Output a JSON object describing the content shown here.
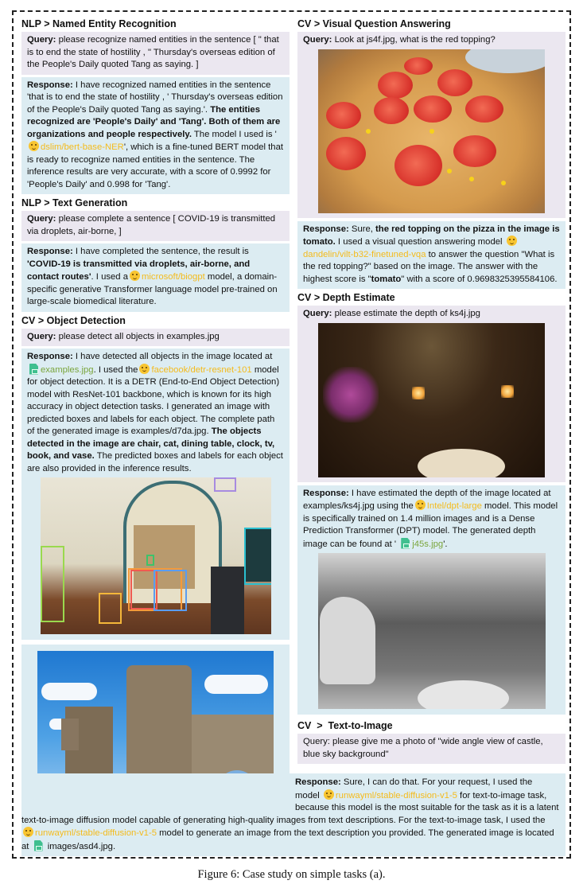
{
  "caption": "Figure 6: Case study on simple tasks (a).",
  "labels": {
    "query": "Query:",
    "response": "Response:"
  },
  "ner": {
    "heading": "NLP > Named Entity Recognition",
    "query": "please recognize named entities in the sentence [ \" that is to end the state of hostility , \" Thursday's overseas edition of the People's Daily quoted Tang as saying. ]",
    "response_1": "I have recognized named entities in the sentence 'that is to end the state of hostility , ' Thursday's overseas edition of the People's Daily quoted Tang as saying.'.",
    "response_bold": "The entities recognized are 'People's Daily' and 'Tang'. Both of them are organizations and people respectively.",
    "response_2": "The model I used is '",
    "model": "dslim/bert-base-NER",
    "response_3": "', which is a fine-tuned BERT model that is ready to recognize named entities in the sentence. The inference results are very accurate, with a score of 0.9992 for 'People's Daily' and 0.998 for 'Tang'."
  },
  "textgen": {
    "heading": "NLP > Text Generation",
    "query": "please complete a sentence [ COVID-19 is transmitted via droplets, air-borne, ]",
    "response_1": "I have completed the sentence, the result is ",
    "response_bold": "'COVID-19 is transmitted via droplets, air-borne, and contact routes'",
    "response_2": ". I used a",
    "model": "microsoft/biogpt",
    "response_3": " model,  a domain-specific generative Transformer language model pre-trained on large-scale biomedical literature."
  },
  "objdet": {
    "heading": "CV > Object Detection",
    "query": "please detect all objects in examples.jpg",
    "response_1": "I have detected all objects in the image located at",
    "file": "examples.jpg",
    "response_2": ". I used the",
    "model": "facebook/detr-resnet-101",
    "response_3": " model for object detection. It is a DETR (End-to-End Object Detection) model with ResNet-101 backbone, which is known for its high accuracy in object detection tasks. I generated an image with predicted boxes and labels for each object. The complete path of the generated image is examples/d7da.jpg.",
    "response_bold": "The objects detected in the image are chair, cat, dining table, clock, tv, book, and vase.",
    "response_4": " The predicted boxes and labels for each object are also provided in the inference results.",
    "image_alt": "living room with detection boxes"
  },
  "vqa": {
    "heading": "CV > Visual Question Answering",
    "query": "Look at js4f.jpg, what is the red topping?",
    "image_alt": "pizza with tomato slices",
    "response_1": "Sure, ",
    "response_bold": "the red topping on the pizza in the image is tomato.",
    "response_2": "  I used a visual question answering model",
    "model": "dandelin/vilt-b32-finetuned-vqa",
    "response_3": " to answer the question \"What is the red topping?\" based on the image. The answer with the highest score is \"",
    "answer": "tomato",
    "response_4": "\" with a score of 0.9698325395584106."
  },
  "depth": {
    "heading": "CV > Depth Estimate",
    "query": "please estimate the depth of ks4j.jpg",
    "image_alt": "dim bathroom with flowers",
    "response_1": "I have estimated the depth of the image located at examples/ks4j.jpg using the",
    "model": "Intel/dpt-large",
    "response_2": " model. This model is specifically trained on 1.4 million images and is a Dense Prediction Transformer (DPT) model. The generated depth image can be found at '",
    "file": "j45s.jpg",
    "response_3": "'.",
    "depth_alt": "grayscale depth map"
  },
  "t2i": {
    "heading": "CV  >  Text-to-Image",
    "query": "Query: please give me a photo of \"wide angle view of castle, blue sky background\"",
    "response_1": "Sure, I can do that. For your request, I used the model",
    "model": "runwayml/stable-diffusion-v1-5",
    "response_2": " for text-to-image task, because this model is the most suitable for the task as it is a latent text-to-image diffusion model capable of generating high-quality images from text descriptions. For the text-to-image task, I used the",
    "model_2": "runwayml/stable-diffusion-v1-5",
    "response_3": " model to generate an image from the text description you provided. The generated image is located at",
    "file": " images/asd4.jpg.",
    "image_alt": "castle under blue sky"
  }
}
